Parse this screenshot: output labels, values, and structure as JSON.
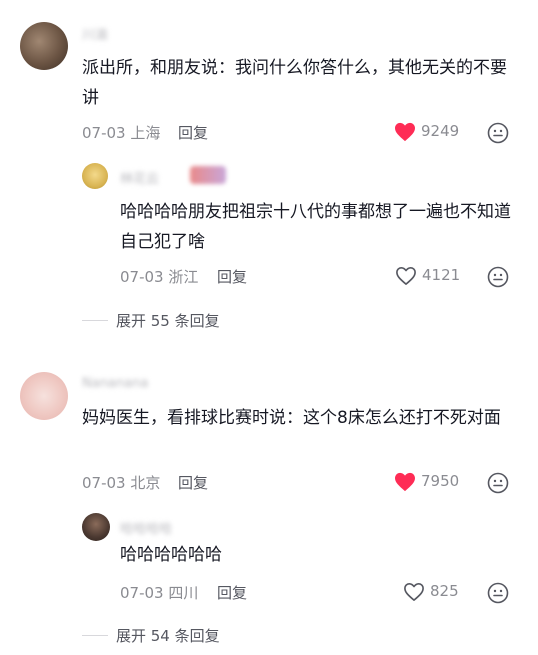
{
  "comments": [
    {
      "username": "川渝",
      "text": "派出所，和朋友说：我问什么你答什么，其他无关的不要讲",
      "date": "07-03",
      "location": "上海",
      "reply_label": "回复",
      "likes": "9249",
      "liked": true,
      "replies": [
        {
          "username": "林花云",
          "text": "哈哈哈哈朋友把祖宗十八代的事都想了一遍也不知道自己犯了啥",
          "date": "07-03",
          "location": "浙江",
          "reply_label": "回复",
          "likes": "4121",
          "liked": false
        }
      ],
      "expand_label": "展开 55 条回复"
    },
    {
      "username": "Nananana",
      "text": "妈妈医生，看排球比赛时说：这个8床怎么还打不死对面",
      "date": "07-03",
      "location": "北京",
      "reply_label": "回复",
      "likes": "7950",
      "liked": true,
      "replies": [
        {
          "username": "哈哈哈哈",
          "text": "哈哈哈哈哈哈",
          "date": "07-03",
          "location": "四川",
          "reply_label": "回复",
          "likes": "825",
          "liked": false
        }
      ],
      "expand_label": "展开 54 条回复"
    }
  ],
  "colors": {
    "like_active": "#fe2c55",
    "meta_gray": "#8a8b91"
  },
  "icons": {
    "like": "heart-icon",
    "emoji": "emoji-icon"
  }
}
